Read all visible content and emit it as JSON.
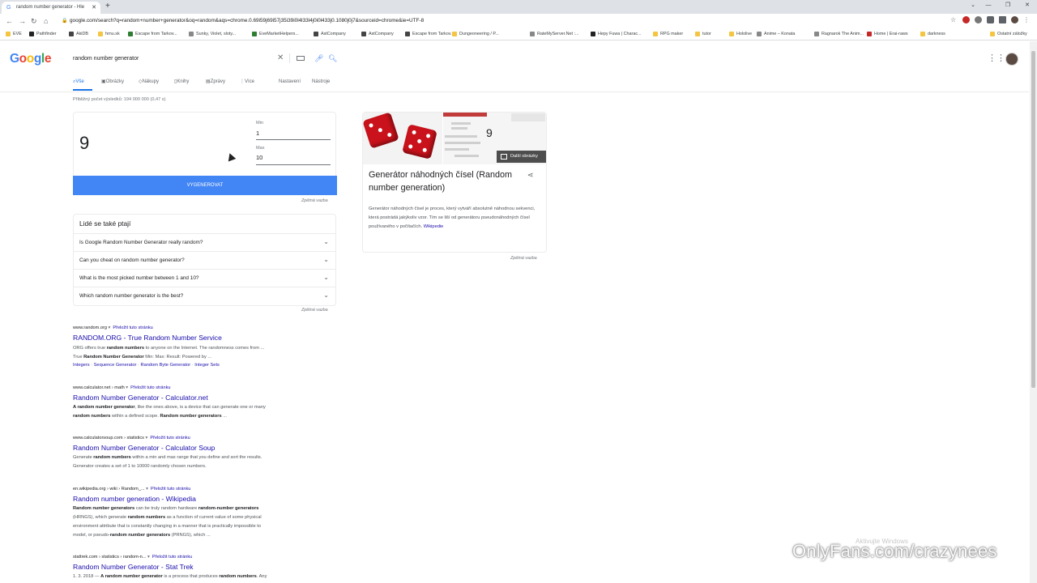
{
  "browser": {
    "tab_title": "random number generator - Hle",
    "url": "google.com/search?q=random+number+generator&oq=random&aqs=chrome.0.69i59j69i57j35i39i0l4l33l4j0i0l433j0.1080j0j7&sourceid=chrome&ie=UTF-8",
    "bookmarks": [
      {
        "label": "EVE",
        "color": "#f4c542"
      },
      {
        "label": "Pathfinder",
        "color": "#222222"
      },
      {
        "label": "AkiDB",
        "color": "#444444"
      },
      {
        "label": "hrnu.sk",
        "color": "#f4c542"
      },
      {
        "label": "Escape from Tarkov...",
        "color": "#2e7d32"
      },
      {
        "label": "Sunky, Violet, sloty...",
        "color": "#888888"
      },
      {
        "label": "EveMarketHelpers...",
        "color": "#2e7d32"
      },
      {
        "label": "AstCompany",
        "color": "#444444"
      },
      {
        "label": "AstCompany",
        "color": "#444444"
      },
      {
        "label": "Escape from Tarkov...",
        "color": "#444444"
      },
      {
        "label": "Dungeoneering / P...",
        "color": "#f4c542"
      },
      {
        "label": "RateMyServer.Net :...",
        "color": "#888888"
      },
      {
        "label": "Hepy Fuwa | Charac...",
        "color": "#222222"
      },
      {
        "label": "RPG maker",
        "color": "#f4c542"
      },
      {
        "label": "tutor",
        "color": "#f4c542"
      },
      {
        "label": "Hololive",
        "color": "#f4c542"
      },
      {
        "label": "Anime – Konata",
        "color": "#888888"
      },
      {
        "label": "Ragnarok The Anim...",
        "color": "#888888"
      },
      {
        "label": "Home | Erai-raws",
        "color": "#c62828"
      },
      {
        "label": "darkness",
        "color": "#f4c542"
      },
      {
        "label": "Ostatní záložky",
        "color": "#f4c542"
      }
    ]
  },
  "search": {
    "query": "random number generator",
    "tabs": [
      "Vše",
      "Obrázky",
      "Nákupy",
      "Knihy",
      "Zprávy",
      "Více",
      "Nastavení",
      "Nástroje"
    ],
    "stats": "Přibližný počet výsledků: 194 000 000 (0,47 s)"
  },
  "rng": {
    "result": "9",
    "min_label": "Min",
    "min_value": "1",
    "max_label": "Max",
    "max_value": "10",
    "button_label": "VYGENEROVAT",
    "feedback": "Zpětná vazba"
  },
  "paa": {
    "title": "Lidé se také ptají",
    "questions": [
      "Is Google Random Number Generator really random?",
      "Can you cheat on random number generator?",
      "What is the most picked number between 1 and 10?",
      "Which random number generator is the best?"
    ],
    "feedback": "Zpětná vazba"
  },
  "results": [
    {
      "url": "www.random.org",
      "translate": "Přeložit tuto stránku",
      "title": "RANDOM.ORG - True Random Number Service",
      "snippet1": "ORG offers true random numbers to anyone on the Internet. The randomness comes from ...",
      "snippet2_pre": "True ",
      "snippet2_bold": "Random Number Generator",
      "snippet2_post": " Min: Max: Result: Powered by ...",
      "links": [
        "Integers",
        "Sequence Generator",
        "Random Byte Generator",
        "Integer Sets"
      ]
    },
    {
      "url": "www.calculator.net › math",
      "translate": "Přeložit tuto stránku",
      "title": "Random Number Generator - Calculator.net",
      "snippet1": "A random number generator, like the ones above, is a device that can generate one or many",
      "snippet2": "random numbers within a defined scope. Random number generators ..."
    },
    {
      "url": "www.calculatorsoup.com › statistics",
      "translate": "Přeložit tuto stránku",
      "title": "Random Number Generator - Calculator Soup",
      "snippet1": "Generate random numbers within a min and max range that you define and sort the results.",
      "snippet2": "Generator creates a set of 1 to 10000 randomly chosen numbers."
    },
    {
      "url": "en.wikipedia.org › wiki › Random_...",
      "translate": "Přeložit tuto stránku",
      "title": "Random number generation - Wikipedia",
      "snippet1": "Random number generators can be truly random hardware random-number generators",
      "snippet2": "(HRNGS), which generate random numbers as a function of current value of some physical",
      "snippet3": "environment attribute that is constantly changing in a manner that is practically impossible to",
      "snippet4": "model, or pseudo-random number generators (PRNGS), which ..."
    },
    {
      "url": "stattrek.com › statistics › random-n...",
      "translate": "Přeložit tuto stránku",
      "title": "Random Number Generator - Stat Trek",
      "snippet1": "1. 3. 2018 — A random number generator is a process that produces random numbers. Any"
    }
  ],
  "knowledge": {
    "title": "Generátor náhodných čísel (Random number generation)",
    "more_images": "Další obrázky",
    "image_number": "9",
    "description": "Generátor náhodných čísel je proces, který vytváří absolutně náhodnou sekvenci, která postrádá jakýkoliv vzor. Tím se liší od generátoru pseudonáhodných čísel používaného v počítačích.",
    "source": "Wikipedie",
    "feedback": "Zpětná vazba"
  },
  "overlay": {
    "activate_windows": "Aktivujte Windows",
    "watermark": "OnlyFans.com/crazynees"
  }
}
